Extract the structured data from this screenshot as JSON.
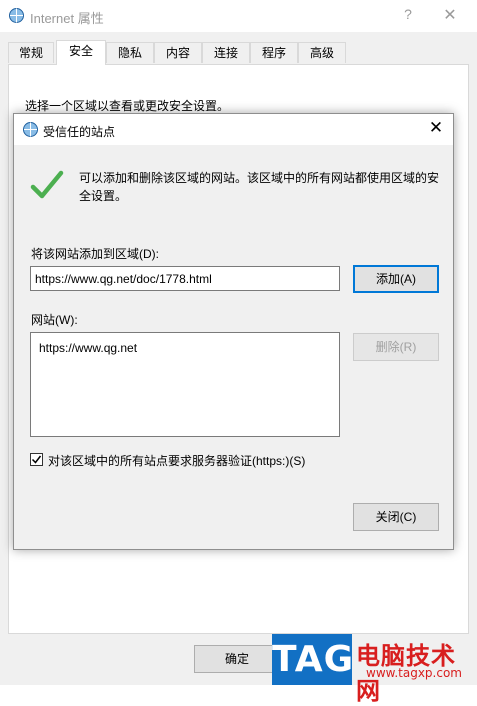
{
  "outer": {
    "title": "Internet 属性",
    "help": "?",
    "close": "✕",
    "tabs": [
      {
        "label": "常规"
      },
      {
        "label": "安全"
      },
      {
        "label": "隐私"
      },
      {
        "label": "内容"
      },
      {
        "label": "连接"
      },
      {
        "label": "程序"
      },
      {
        "label": "高级"
      }
    ],
    "active_tab": "安全",
    "panel_text": "选择一个区域以查看或更改安全设置。",
    "ok_label": "确定"
  },
  "dialog": {
    "title": "受信任的站点",
    "close": "✕",
    "intro": "可以添加和删除该区域的网站。该区域中的所有网站都使用区域的安全设置。",
    "add_label": "将该网站添加到区域(D):",
    "input_value": "https://www.qg.net/doc/1778.html",
    "add_button": "添加(A)",
    "sites_label": "网站(W):",
    "sites": [
      "https://www.qg.net"
    ],
    "remove_button": "删除(R)",
    "https_checkbox_label": "对该区域中的所有站点要求服务器验证(https:)(S)",
    "https_checked": true,
    "close_button": "关闭(C)"
  },
  "watermark": {
    "logo": "TAG",
    "name": "电脑技术网",
    "url": "www.tagxp.com"
  },
  "colors": {
    "accent": "#0078d7",
    "check_green": "#4caf50",
    "watermark_blue": "#1270c4",
    "watermark_red": "#d81e1e"
  }
}
